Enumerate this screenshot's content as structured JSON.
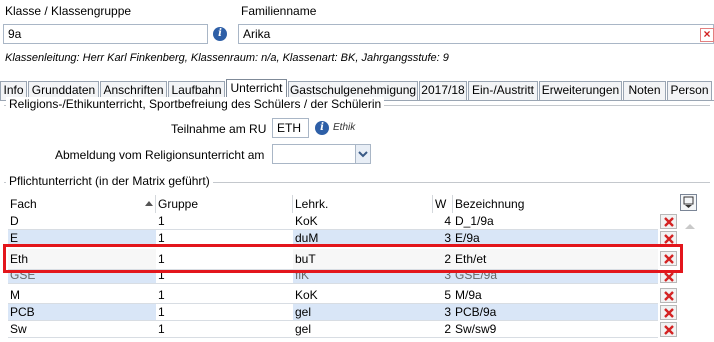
{
  "header": {
    "klasse_label": "Klasse / Klassengruppe",
    "klasse_value": "9a",
    "familienname_label": "Familienname",
    "familienname_value": "Arika",
    "info_line": "Klassenleitung: Herr Karl Finkenberg, Klassenraum: n/a, Klassenart: BK, Jahrgangsstufe: 9"
  },
  "tabs": [
    {
      "label": "Info"
    },
    {
      "label": "Grunddaten"
    },
    {
      "label": "Anschriften"
    },
    {
      "label": "Laufbahn"
    },
    {
      "label": "Unterricht",
      "active": true
    },
    {
      "label": "Gastschulgenehmigung"
    },
    {
      "label": "2017/18"
    },
    {
      "label": "Ein-/Austritt"
    },
    {
      "label": "Erweiterungen"
    },
    {
      "label": "Noten"
    },
    {
      "label": "Person"
    }
  ],
  "religion": {
    "group_title": "Religions-/Ethikunterricht, Sportbefreiung des Schülers / der Schülerin",
    "teilnahme_label": "Teilnahme am RU",
    "teilnahme_value": "ETH",
    "teilnahme_hint": "Ethik",
    "abmeldung_label": "Abmeldung vom Religionsunterricht am",
    "abmeldung_value": ""
  },
  "pflicht": {
    "group_title": "Pflichtunterricht (in der Matrix geführt)",
    "columns": [
      "Fach",
      "Gruppe",
      "Lehrk.",
      "W",
      "Bezeichnung"
    ],
    "rows": [
      {
        "fach": "D",
        "gruppe": "1",
        "lehrk": "KoK",
        "w": "4",
        "bez": "D_1/9a"
      },
      {
        "fach": "E",
        "gruppe": "1",
        "lehrk": "duM",
        "w": "3",
        "bez": "E/9a"
      },
      {
        "fach": "Eth",
        "gruppe": "1",
        "lehrk": "buT",
        "w": "2",
        "bez": "Eth/et"
      },
      {
        "fach": "GSE",
        "gruppe": "1",
        "lehrk": "fiK",
        "w": "3",
        "bez": "GSE/9a"
      },
      {
        "fach": "M",
        "gruppe": "1",
        "lehrk": "KoK",
        "w": "5",
        "bez": "M/9a"
      },
      {
        "fach": "PCB",
        "gruppe": "1",
        "lehrk": "gel",
        "w": "3",
        "bez": "PCB/9a"
      },
      {
        "fach": "Sw",
        "gruppe": "1",
        "lehrk": "gel",
        "w": "2",
        "bez": "Sw/sw9"
      }
    ]
  },
  "colors": {
    "highlight": "#e3161c",
    "row_alt": "#d9e6f7",
    "accent": "#2e5fa7"
  }
}
